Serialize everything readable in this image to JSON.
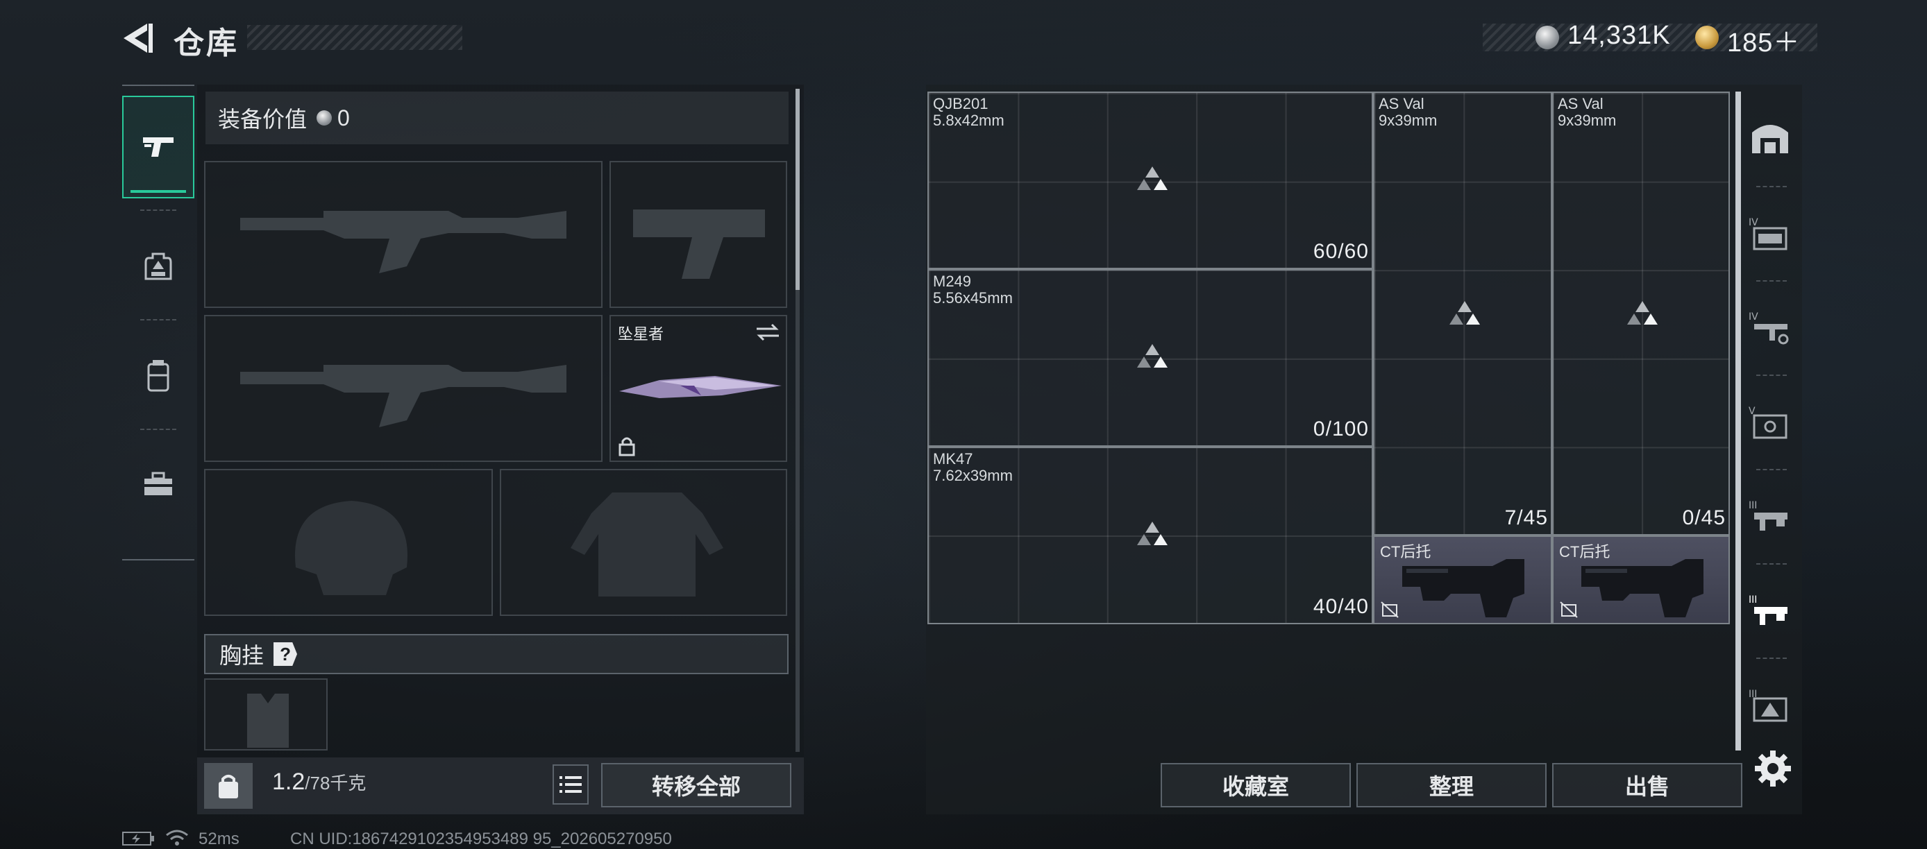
{
  "header": {
    "title": "仓库",
    "currency": {
      "silver": "14,331K",
      "gold": "185＋"
    }
  },
  "left": {
    "tabs": [
      "pistol-tab",
      "backpack-tab",
      "rig-tab",
      "case-tab"
    ],
    "equipment_value_label": "装备价值",
    "equipment_value": "0",
    "melee_name": "坠星者",
    "chest_rig_label": "胸挂",
    "chest_rig_help": "?",
    "weight_value": "1.2",
    "weight_unit": "/78千克",
    "transfer_all": "转移全部"
  },
  "grid": {
    "cells": [
      {
        "name": "QJB201",
        "caliber": "5.8x42mm",
        "count": "60/60"
      },
      {
        "name": "M249",
        "caliber": "5.56x45mm",
        "count": "0/100"
      },
      {
        "name": "MK47",
        "caliber": "7.62x39mm",
        "count": "40/40"
      },
      {
        "name": "AS Val",
        "caliber": "9x39mm",
        "count": "7/45"
      },
      {
        "name": "AS Val",
        "caliber": "9x39mm",
        "count": "0/45"
      }
    ],
    "stocks": [
      {
        "name": "CT后托"
      },
      {
        "name": "CT后托"
      }
    ]
  },
  "buttons": {
    "collection": "收藏室",
    "sort": "整理",
    "sell": "出售"
  },
  "status": {
    "ping": "52ms",
    "uid": "CN UID:1867429102354953489 95_202605270950"
  },
  "colors": {
    "accent": "#29c99a",
    "stock_bg": "#4e5061"
  }
}
